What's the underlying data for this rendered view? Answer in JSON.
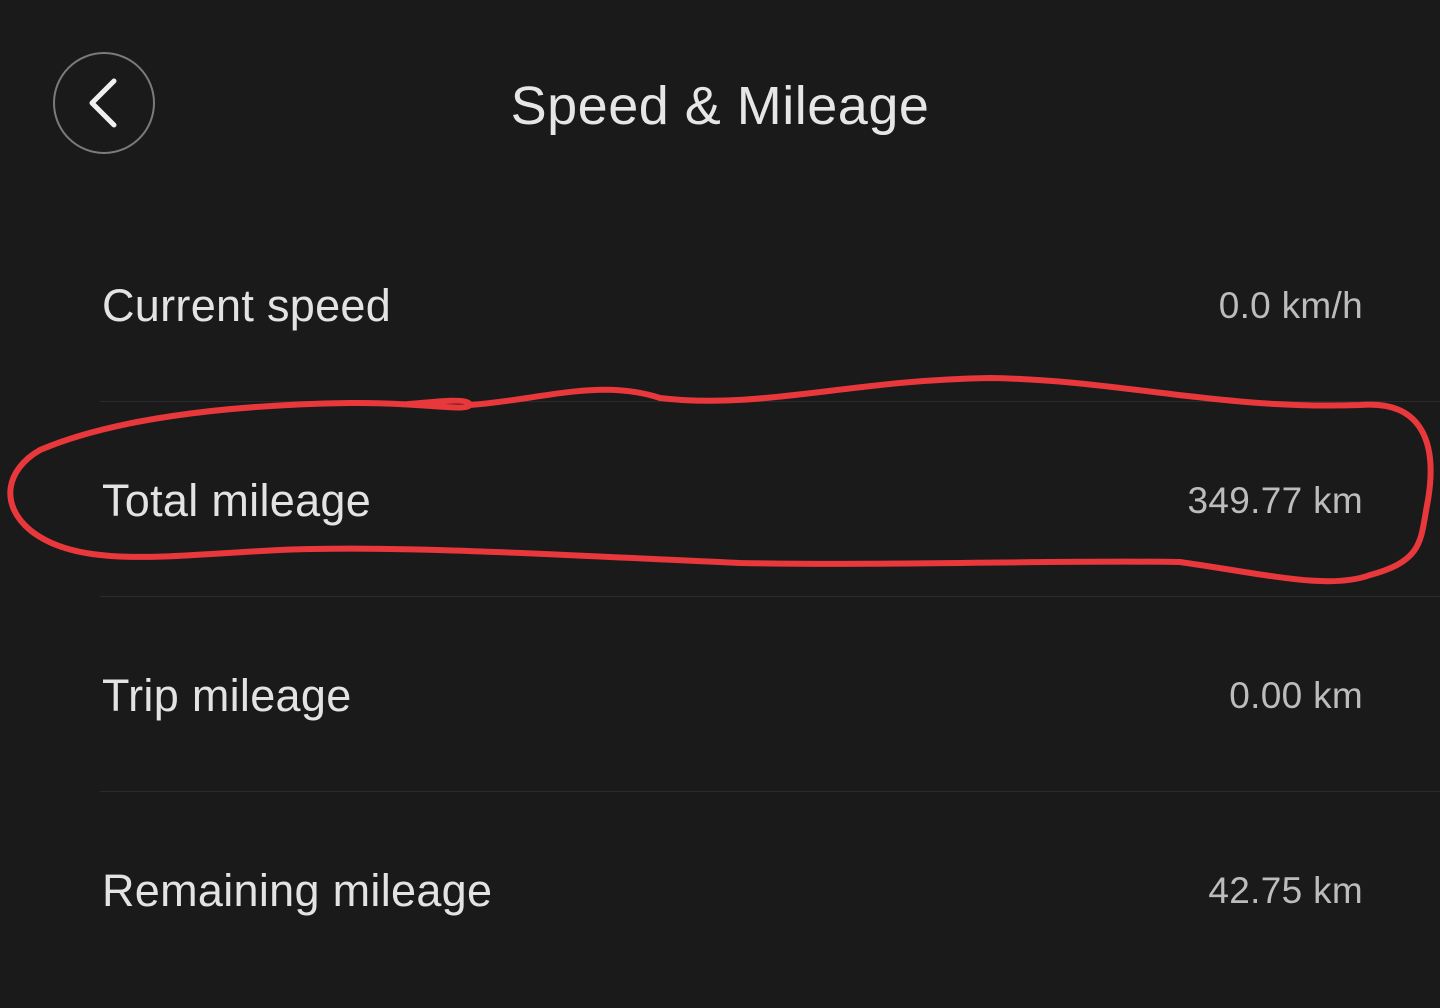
{
  "header": {
    "title": "Speed & Mileage",
    "back_icon": "chevron-left-icon"
  },
  "rows": [
    {
      "label": "Current speed",
      "value": "0.0 km/h"
    },
    {
      "label": "Total mileage",
      "value": "349.77 km"
    },
    {
      "label": "Trip mileage",
      "value": "0.00 km"
    },
    {
      "label": "Remaining mileage",
      "value": "42.75 km"
    }
  ],
  "colors": {
    "background": "#1a1a1b",
    "annotation": "#e8383b"
  }
}
